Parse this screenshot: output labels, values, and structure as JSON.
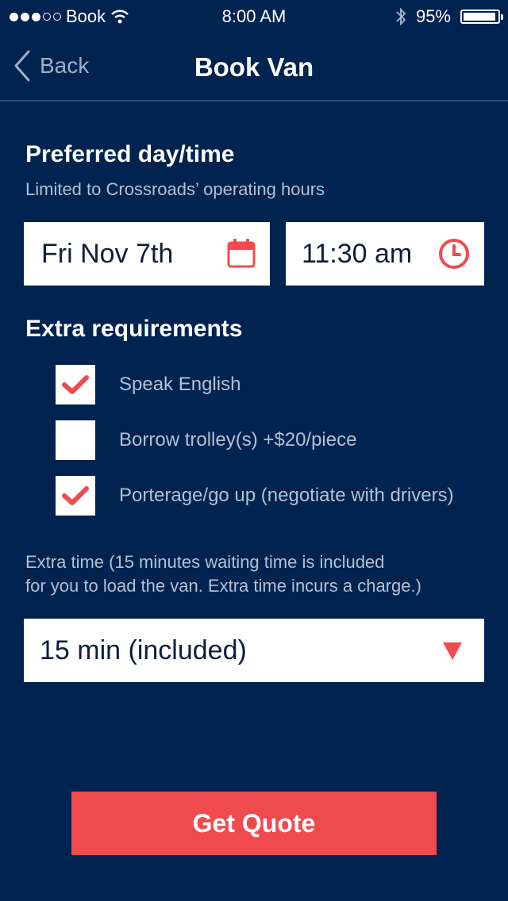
{
  "status_bar": {
    "carrier": "Book",
    "time": "8:00 AM",
    "battery": "95%",
    "battery_level": 0.95,
    "signal_dots_filled": 3,
    "signal_dots_total": 5
  },
  "nav": {
    "back_label": "Back",
    "title": "Book Van"
  },
  "preferred": {
    "heading": "Preferred day/time",
    "subtitle": "Limited to Crossroads’ operating hours",
    "date_value": "Fri Nov 7th",
    "time_value": "11:30 am"
  },
  "extra_requirements": {
    "heading": "Extra requirements",
    "items": [
      {
        "label": "Speak English",
        "checked": true
      },
      {
        "label": "Borrow trolley(s) +$20/piece",
        "checked": false
      },
      {
        "label": "Porterage/go up (negotiate with drivers)",
        "checked": true
      }
    ]
  },
  "extra_time": {
    "note_line1": "Extra time (15 minutes waiting time is included",
    "note_line2": "for you to load the van. Extra time incurs a charge.)",
    "selected": "15 min (included)"
  },
  "cta": {
    "label": "Get Quote"
  },
  "colors": {
    "background": "#00234f",
    "accent": "#f04a4f",
    "muted_text": "#b3c0d4"
  }
}
